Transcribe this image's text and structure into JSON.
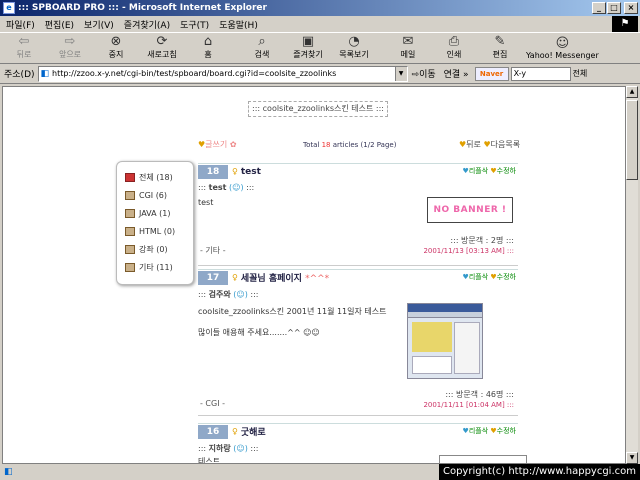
{
  "window": {
    "title": "::: SPBOARD PRO ::: - Microsoft Internet Explorer",
    "min": "_",
    "max": "□",
    "close": "×"
  },
  "menu": [
    "파일(F)",
    "편집(E)",
    "보기(V)",
    "즐겨찾기(A)",
    "도구(T)",
    "도움말(H)"
  ],
  "toolbar": {
    "back": "뒤로",
    "forward": "앞으로",
    "stop": "중지",
    "refresh": "새로고침",
    "home": "홈",
    "search": "검색",
    "favorites": "즐겨찾기",
    "history": "목록보기",
    "mail": "메일",
    "print": "인쇄",
    "edit": "편집",
    "messenger": "Yahoo! Messenger"
  },
  "address": {
    "label": "주소(D)",
    "url": "http://zzoo.x-y.net/cgi-bin/test/spboard/board.cgi?id=coolsite_zzoolinks",
    "go": "이동",
    "links": "연결 »",
    "naver": "Naver",
    "search_value": "X-y",
    "search_all": "전체"
  },
  "board": {
    "title": "::: coolsite_zzoolinks스킨 테스트 :::",
    "nav_left": "글쓰기",
    "total_prefix": "Total ",
    "total_count": "18",
    "total_suffix": " articles (1/2 Page)",
    "nav_right_back": "뒤로",
    "nav_right_next": "다음목록"
  },
  "categories": [
    {
      "label": "전체 (18)"
    },
    {
      "label": "CGI (6)"
    },
    {
      "label": "JAVA (1)"
    },
    {
      "label": "HTML (0)"
    },
    {
      "label": "강좌 (0)"
    },
    {
      "label": "기타 (11)"
    }
  ],
  "posts": [
    {
      "no": "18",
      "subject": "test",
      "deco": "",
      "author": "test",
      "mail": "(☺)",
      "body": "test",
      "body2": "",
      "visits": "::: 방문객 : 2명 :::",
      "date": "2001/11/13 [03:13 AM] :::",
      "category": "- 기타 -",
      "reply": "리플삭",
      "modify": "수정하"
    },
    {
      "no": "17",
      "subject": "세꼴님 홈페이지 ",
      "deco": "*^^*",
      "author": "검주와",
      "mail": "(☺)",
      "body": "coolsite_zzoolinks스킨 2001년 11월 11일자 테스트",
      "body2": "많이들 애용해 주세요.......^^ ☺☺",
      "visits": "::: 방문객 : 46명 :::",
      "date": "2001/11/11 [01:04 AM] :::",
      "category": "- CGI -",
      "reply": "리플삭",
      "modify": "수정하"
    },
    {
      "no": "16",
      "subject": "굿해로",
      "deco": "",
      "author": "지하랑",
      "mail": "(☺)",
      "body": "테스트",
      "body2": "",
      "visits": "",
      "date": "",
      "category": "",
      "reply": "리플삭",
      "modify": "수정하"
    }
  ],
  "banner": "NO BANNER !",
  "status": {
    "copyright": "Copyright(c) http://www.happycgi.com"
  }
}
